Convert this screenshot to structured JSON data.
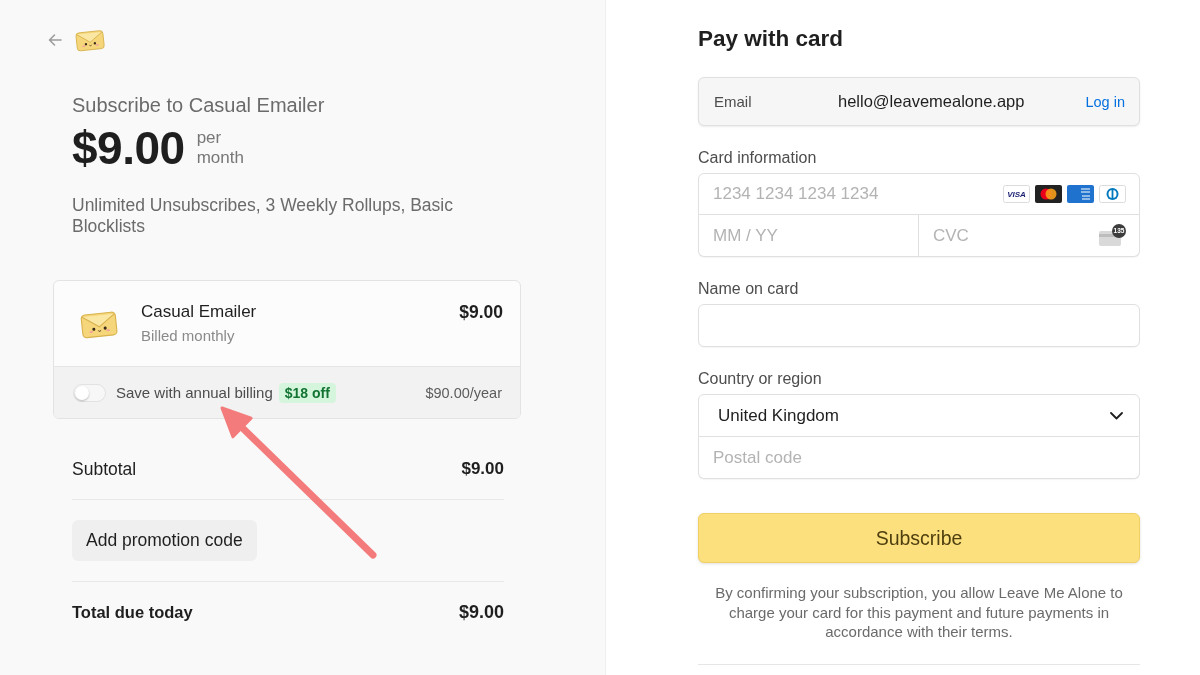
{
  "summary_panel": {
    "heading": "Subscribe to Casual Emailer",
    "price": "$9.00",
    "period": "per month",
    "description": "Unlimited Unsubscribes, 3 Weekly Rollups, Basic Blocklists"
  },
  "line_item": {
    "name": "Casual Emailer",
    "billing": "Billed monthly",
    "amount": "$9.00"
  },
  "annual_billing": {
    "on": false,
    "label": "Save with annual billing",
    "badge": "$18 off",
    "price": "$90.00/year"
  },
  "totals": [
    {
      "kind": "row",
      "label": "Subtotal",
      "amount": "$9.00"
    },
    {
      "kind": "button",
      "label": "Add promotion code"
    },
    {
      "kind": "total",
      "label": "Total due today",
      "amount": "$9.00"
    }
  ],
  "payment": {
    "title": "Pay with card",
    "email": {
      "label": "Email",
      "value": "hello@leavemealone.app",
      "link": "Log in"
    },
    "card": {
      "label": "Card information",
      "number_placeholder": "1234 1234 1234 1234",
      "expiry_placeholder": "MM / YY",
      "cvc_placeholder": "CVC",
      "cvc_hint": "135",
      "brands": [
        {
          "kind": "visa",
          "label": "VISA"
        },
        {
          "kind": "mastercard"
        },
        {
          "kind": "amex"
        },
        {
          "kind": "diners"
        }
      ]
    },
    "name_on_card": {
      "label": "Name on card"
    },
    "country": {
      "label": "Country or region",
      "value": "United Kingdom",
      "postal_placeholder": "Postal code"
    },
    "submit": "Subscribe",
    "terms": "By confirming your subscription, you allow Leave Me Alone to charge your card for this payment and future payments in accordance with their terms."
  }
}
